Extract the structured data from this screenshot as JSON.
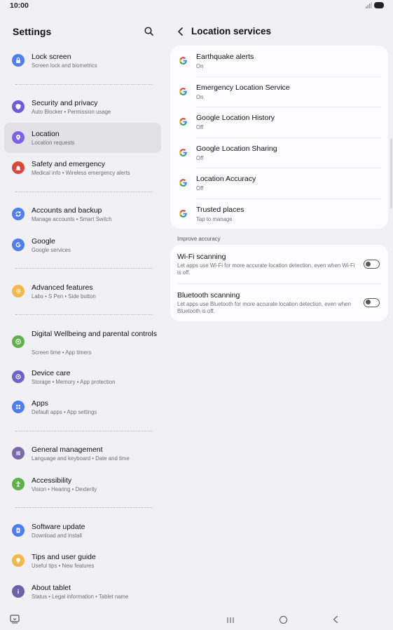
{
  "status_bar": {
    "time": "10:00"
  },
  "left_pane": {
    "title": "Settings",
    "items": [
      {
        "title": "Lock screen",
        "subtitle": "Screen lock and biometrics",
        "icon": "lock-icon",
        "color": "#4f7df2"
      },
      {
        "title": "Security and privacy",
        "subtitle": "Auto Blocker  •  Permission usage",
        "icon": "shield-icon",
        "color": "#6d5ed8"
      },
      {
        "title": "Location",
        "subtitle": "Location requests",
        "icon": "location-pin-icon",
        "color": "#7b62e8"
      },
      {
        "title": "Safety and emergency",
        "subtitle": "Medical info  •  Wireless emergency alerts",
        "icon": "emergency-bell-icon",
        "color": "#d9473d"
      },
      {
        "title": "Accounts and backup",
        "subtitle": "Manage accounts  •  Smart Switch",
        "icon": "sync-icon",
        "color": "#4f7df2"
      },
      {
        "title": "Google",
        "subtitle": "Google services",
        "icon": "google-g-icon",
        "color": "#4f7df2"
      },
      {
        "title": "Advanced features",
        "subtitle": "Labs  •  S Pen  •  Side button",
        "icon": "gear-plus-icon",
        "color": "#f2b84b"
      },
      {
        "title": "Digital Wellbeing and parental controls",
        "subtitle": "Screen time  •  App timers",
        "icon": "wellbeing-icon",
        "color": "#5fb14a"
      },
      {
        "title": "Device care",
        "subtitle": "Storage  •  Memory  •  App protection",
        "icon": "device-care-icon",
        "color": "#6a63c9"
      },
      {
        "title": "Apps",
        "subtitle": "Default apps  •  App settings",
        "icon": "apps-grid-icon",
        "color": "#4f7df2"
      },
      {
        "title": "General management",
        "subtitle": "Language and keyboard  •  Date and time",
        "icon": "sliders-icon",
        "color": "#7a6aa8"
      },
      {
        "title": "Accessibility",
        "subtitle": "Vision  •  Hearing  •  Dexterity",
        "icon": "accessibility-icon",
        "color": "#5fb14a"
      },
      {
        "title": "Software update",
        "subtitle": "Download and install",
        "icon": "software-update-icon",
        "color": "#4f7df2"
      },
      {
        "title": "Tips and user guide",
        "subtitle": "Useful tips  •  New features",
        "icon": "lightbulb-icon",
        "color": "#f2b84b"
      },
      {
        "title": "About tablet",
        "subtitle": "Status  •  Legal information  •  Tablet name",
        "icon": "info-icon",
        "color": "#6a63a8"
      }
    ]
  },
  "right_pane": {
    "title": "Location services",
    "services": [
      {
        "title": "Earthquake alerts",
        "subtitle": "On"
      },
      {
        "title": "Emergency Location Service",
        "subtitle": "On"
      },
      {
        "title": "Google Location History",
        "subtitle": "Off"
      },
      {
        "title": "Google Location Sharing",
        "subtitle": "Off"
      },
      {
        "title": "Location Accuracy",
        "subtitle": "Off"
      },
      {
        "title": "Trusted places",
        "subtitle": "Tap to manage"
      }
    ],
    "section_label": "Improve accuracy",
    "toggles": [
      {
        "title": "Wi-Fi scanning",
        "description": "Let apps use Wi-Fi for more accurate location detection, even when Wi-Fi is off.",
        "state": "off"
      },
      {
        "title": "Bluetooth scanning",
        "description": "Let apps use Bluetooth for more accurate location detection, even when Bluetooth is off.",
        "state": "off"
      }
    ]
  }
}
